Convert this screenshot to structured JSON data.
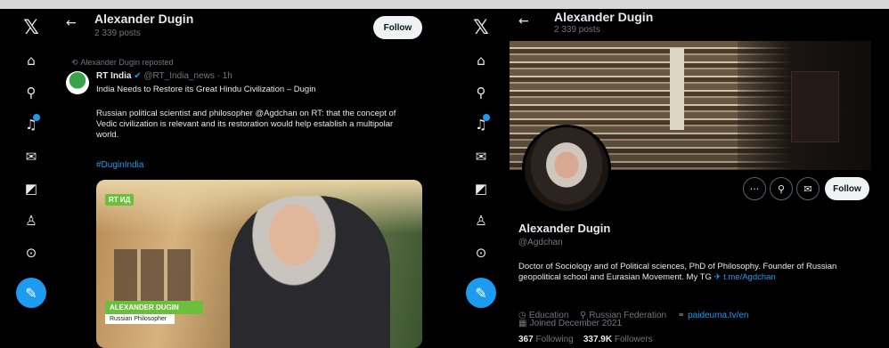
{
  "rail": {
    "items": [
      {
        "name": "x-logo-icon",
        "glyph": "𝕏"
      },
      {
        "name": "home-icon",
        "glyph": "⌂"
      },
      {
        "name": "search-icon",
        "glyph": "⚲"
      },
      {
        "name": "notifications-icon",
        "glyph": "♫"
      },
      {
        "name": "messages-icon",
        "glyph": "✉"
      },
      {
        "name": "grok-icon",
        "glyph": "◩"
      },
      {
        "name": "profile-icon",
        "glyph": "♙"
      },
      {
        "name": "more-icon",
        "glyph": "⊙"
      }
    ],
    "post_glyph": "✎"
  },
  "left": {
    "header": {
      "back": "←",
      "name": "Alexander Dugin",
      "sub": "2 339 posts",
      "follow": "Follow"
    },
    "repost_label": "Alexander Dugin reposted",
    "tweet": {
      "author": "RT India",
      "handle": "@RT_India_news · 1h",
      "headline": "India Needs to Restore its Great Hindu Civilization – Dugin",
      "body": "Russian political scientist and philosopher @Agdchan on RT: that the concept of Vedic civilization is relevant and its restoration would help establish a multipolar world.",
      "mention": "@Agdchan",
      "hashtag": "#DuginIndia",
      "video_badge": "RT ИД",
      "video_name": "ALEXANDER DUGIN",
      "video_role": "Russian Philosopher"
    }
  },
  "right": {
    "header": {
      "back": "←",
      "name": "Alexander Dugin",
      "sub": "2 339 posts"
    },
    "profile": {
      "name": "Alexander Dugin",
      "handle": "@Agdchan",
      "bio": "Doctor of Sociology and of Political sciences, PhD of Philosophy. Founder of Russian geopolitical school and Eurasian Movement. My TG",
      "bio_link": "t.me/Agdchan",
      "category": "Education",
      "location": "Russian Federation",
      "website": "paideuma.tv/en",
      "joined": "Joined December 2021",
      "following_count": "367",
      "following_label": "Following",
      "followers_count": "337.9K",
      "followers_label": "Followers",
      "follow": "Follow"
    },
    "actions": {
      "more": "···",
      "search": "⚲",
      "message": "✉"
    }
  },
  "colors": {
    "accent": "#1d9bf0",
    "bg": "#000000",
    "muted": "#71767b"
  }
}
